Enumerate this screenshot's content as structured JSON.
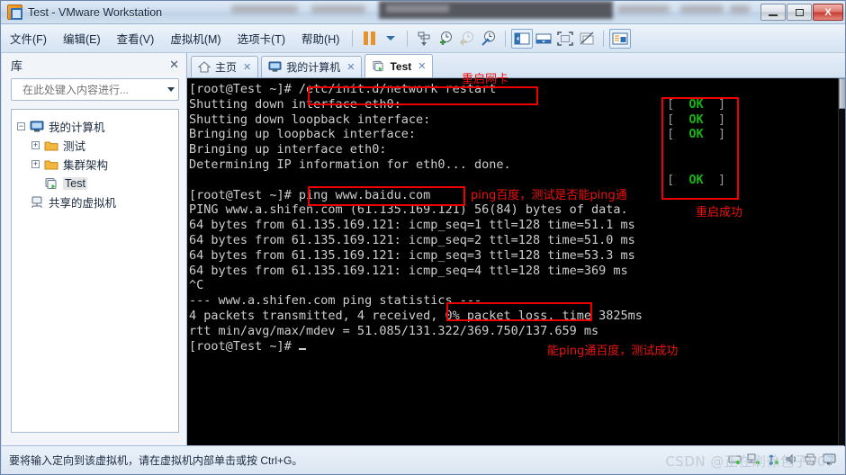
{
  "window": {
    "title": "Test - VMware Workstation",
    "app_icon": "vmware-icon",
    "minimize_label": "",
    "maximize_label": "",
    "close_label": "X"
  },
  "menubar": {
    "items": [
      {
        "label": "文件(F)",
        "name": "menu-file"
      },
      {
        "label": "编辑(E)",
        "name": "menu-edit"
      },
      {
        "label": "查看(V)",
        "name": "menu-view"
      },
      {
        "label": "虚拟机(M)",
        "name": "menu-vm"
      },
      {
        "label": "选项卡(T)",
        "name": "menu-tabs"
      },
      {
        "label": "帮助(H)",
        "name": "menu-help"
      }
    ],
    "toolbar_icons": [
      "pause-icon",
      "dropdown-caret-icon",
      "power-down-icon",
      "snapshot-add-icon",
      "snapshot-revert-icon",
      "snapshot-manager-icon",
      "show-library-icon",
      "show-thumbnail-bar-icon",
      "full-screen-icon",
      "unity-mode-icon",
      "console-view-icon"
    ]
  },
  "library": {
    "title": "库",
    "close_label": "✕",
    "search_placeholder": "在此处键入内容进行...",
    "search_value": "",
    "tree": [
      {
        "label": "我的计算机",
        "icon": "computer-icon",
        "expander": "−",
        "indent": 0
      },
      {
        "label": "测试",
        "icon": "folder-icon",
        "expander": "+",
        "indent": 1
      },
      {
        "label": "集群架构",
        "icon": "folder-icon",
        "expander": "+",
        "indent": 1
      },
      {
        "label": "Test",
        "icon": "vm-running-icon",
        "expander": "",
        "indent": 1,
        "selected": true
      },
      {
        "label": "共享的虚拟机",
        "icon": "shared-vm-icon",
        "expander": "",
        "indent": 0
      }
    ]
  },
  "tabs": [
    {
      "label": "主页",
      "icon": "home-icon",
      "close": "✕",
      "active": false
    },
    {
      "label": "我的计算机",
      "icon": "computer-icon",
      "close": "✕",
      "active": false
    },
    {
      "label": "Test",
      "icon": "vm-running-icon",
      "close": "✕",
      "active": true
    }
  ],
  "terminal": {
    "lines": [
      "[root@Test ~]# /etc/init.d/network restart",
      "Shutting down interface eth0:",
      "Shutting down loopback interface:",
      "Bringing up loopback interface:",
      "Bringing up interface eth0:",
      "Determining IP information for eth0... done.",
      "",
      "[root@Test ~]# ping www.baidu.com",
      "PING www.a.shifen.com (61.135.169.121) 56(84) bytes of data.",
      "64 bytes from 61.135.169.121: icmp_seq=1 ttl=128 time=51.1 ms",
      "64 bytes from 61.135.169.121: icmp_seq=2 ttl=128 time=51.0 ms",
      "64 bytes from 61.135.169.121: icmp_seq=3 ttl=128 time=53.3 ms",
      "64 bytes from 61.135.169.121: icmp_seq=4 ttl=128 time=369 ms",
      "^C",
      "--- www.a.shifen.com ping statistics ---",
      "4 packets transmitted, 4 received, 0% packet loss, time 3825ms",
      "rtt min/avg/max/mdev = 51.085/131.322/369.750/137.659 ms",
      "[root@Test ~]# "
    ],
    "status_results": [
      {
        "line_index": 1,
        "bracket_open": "[",
        "text": "OK",
        "bracket_close": "]"
      },
      {
        "line_index": 2,
        "bracket_open": "[",
        "text": "OK",
        "bracket_close": "]"
      },
      {
        "line_index": 3,
        "bracket_open": "[",
        "text": "OK",
        "bracket_close": "]"
      },
      {
        "line_index": 6,
        "bracket_open": "[",
        "text": "OK",
        "bracket_close": "]"
      }
    ],
    "fg_color": "#cfcfcf",
    "ok_color": "#17b517",
    "bg_color": "#000000"
  },
  "annotations": {
    "color": "#ee1111",
    "notes": [
      {
        "text": "重启网卡",
        "name": "annotation-restart-nic"
      },
      {
        "text": "ping百度，测试是否能ping通",
        "name": "annotation-ping-baidu"
      },
      {
        "text": "重启成功",
        "name": "annotation-restart-success"
      },
      {
        "text": "能ping通百度，测试成功",
        "name": "annotation-ping-success"
      }
    ],
    "boxes": [
      {
        "name": "highlight-network-restart-command"
      },
      {
        "name": "highlight-ok-results"
      },
      {
        "name": "highlight-ping-command"
      },
      {
        "name": "highlight-packet-loss"
      }
    ]
  },
  "statusbar": {
    "message": "要将输入定向到该虚拟机，请在虚拟机内部单击或按 Ctrl+G。",
    "watermark": "CSDN @正在刷徐包子007",
    "device_icons": [
      "hdd-icon",
      "network-icon",
      "usb-icon",
      "sound-icon",
      "printer-icon",
      "display-icon"
    ]
  }
}
